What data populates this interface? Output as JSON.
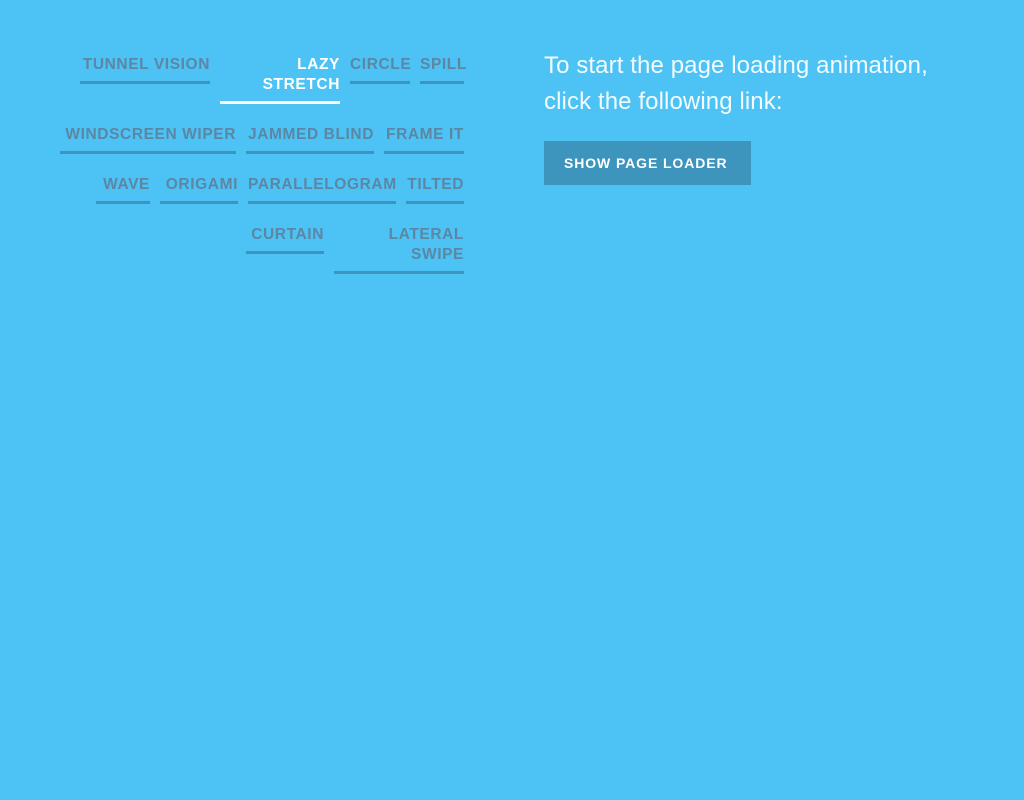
{
  "theme": {
    "background_color": "#4dc2f5",
    "accent_color": "#3d94bd",
    "inactive_text_color": "#5b87a5",
    "active_text_color": "#ffffff"
  },
  "effects_panel": {
    "items": [
      {
        "label": "Lazy Stretch",
        "active": true
      },
      {
        "label": "Circle",
        "active": false
      },
      {
        "label": "Spill",
        "active": false
      },
      {
        "label": "Frame It",
        "active": false
      },
      {
        "label": "Tunnel Vision",
        "active": false
      },
      {
        "label": "Windscreen Wiper",
        "active": false
      },
      {
        "label": "Jammed Blind",
        "active": false
      },
      {
        "label": "Parallelogram",
        "active": false
      },
      {
        "label": "Tilted",
        "active": false
      },
      {
        "label": "Lateral Swipe",
        "active": false
      },
      {
        "label": "Wave",
        "active": false
      },
      {
        "label": "Origami",
        "active": false
      },
      {
        "label": "Curtain",
        "active": false
      }
    ]
  },
  "intro_panel": {
    "text": "To start the page loading animation, click the following link:",
    "button_label": "Show Page Loader"
  }
}
